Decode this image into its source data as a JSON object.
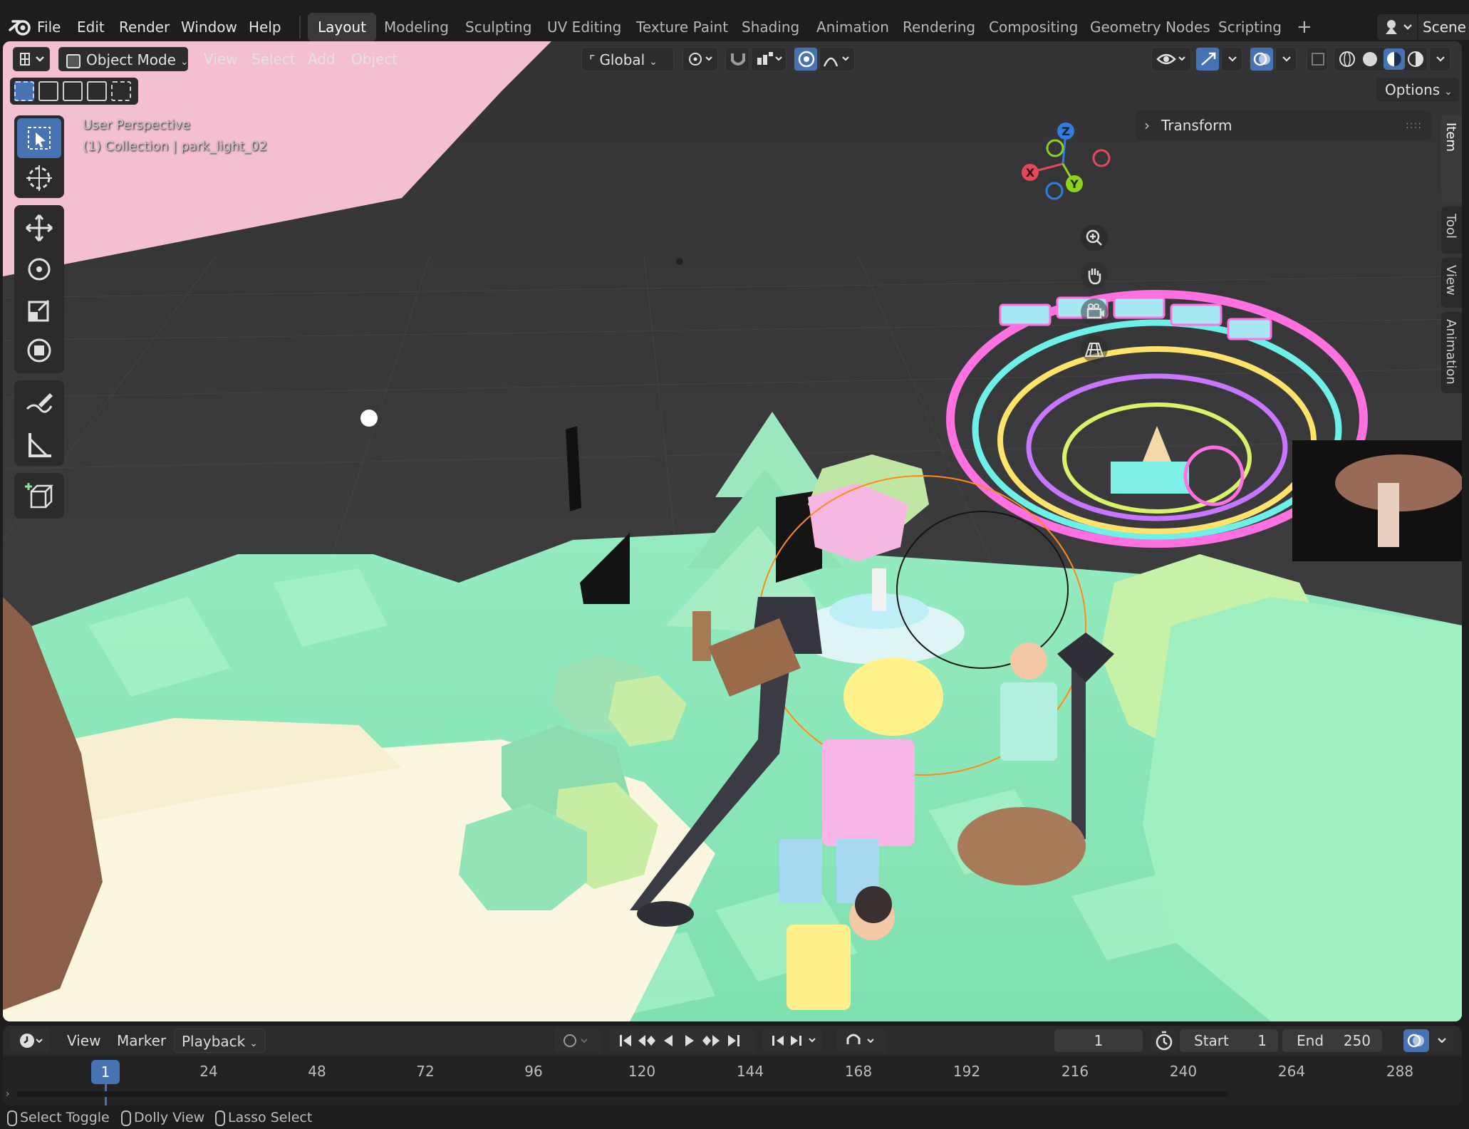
{
  "menu": {
    "items": [
      "File",
      "Edit",
      "Render",
      "Window",
      "Help"
    ],
    "workspaces": [
      "Layout",
      "Modeling",
      "Sculpting",
      "UV Editing",
      "Texture Paint",
      "Shading",
      "Animation",
      "Rendering",
      "Compositing",
      "Geometry Nodes",
      "Scripting"
    ],
    "active_workspace": "Layout",
    "add_tab_label": "+",
    "scene_label": "Scene"
  },
  "viewport_header": {
    "mode": "Object Mode",
    "menus": [
      "View",
      "Select",
      "Add",
      "Object"
    ],
    "transform_orientation": "Global",
    "options_label": "Options"
  },
  "overlay": {
    "perspective": "User Perspective",
    "collection_info": "(1) Collection | park_light_02"
  },
  "sidebar": {
    "panel_title": "Transform",
    "tabs": [
      "Item",
      "Tool",
      "View",
      "Animation"
    ],
    "active_tab": "Item"
  },
  "gizmo": {
    "x_label": "X",
    "y_label": "Y",
    "z_label": "Z"
  },
  "timeline": {
    "menus": [
      "View",
      "Marker",
      "Playback"
    ],
    "current_frame": "1",
    "start_label": "Start",
    "start_value": "1",
    "end_label": "End",
    "end_value": "250",
    "ruler_ticks": [
      "24",
      "48",
      "72",
      "96",
      "120",
      "144",
      "168",
      "192",
      "216",
      "240",
      "264",
      "288"
    ],
    "ruler_current": "1"
  },
  "statusbar": {
    "items": [
      "Select Toggle",
      "Dolly View",
      "Lasso Select"
    ]
  },
  "colors": {
    "accent": "#4772b3",
    "ui_bg": "#1d1d1d",
    "panel_bg": "#2b2b2b",
    "ground": "#8fe8b9",
    "path": "#fbf6df",
    "pink_sky": "#f4bfd2",
    "axis_x": "#e04b5c",
    "axis_y": "#8dd21f",
    "axis_z": "#2f7dde"
  }
}
